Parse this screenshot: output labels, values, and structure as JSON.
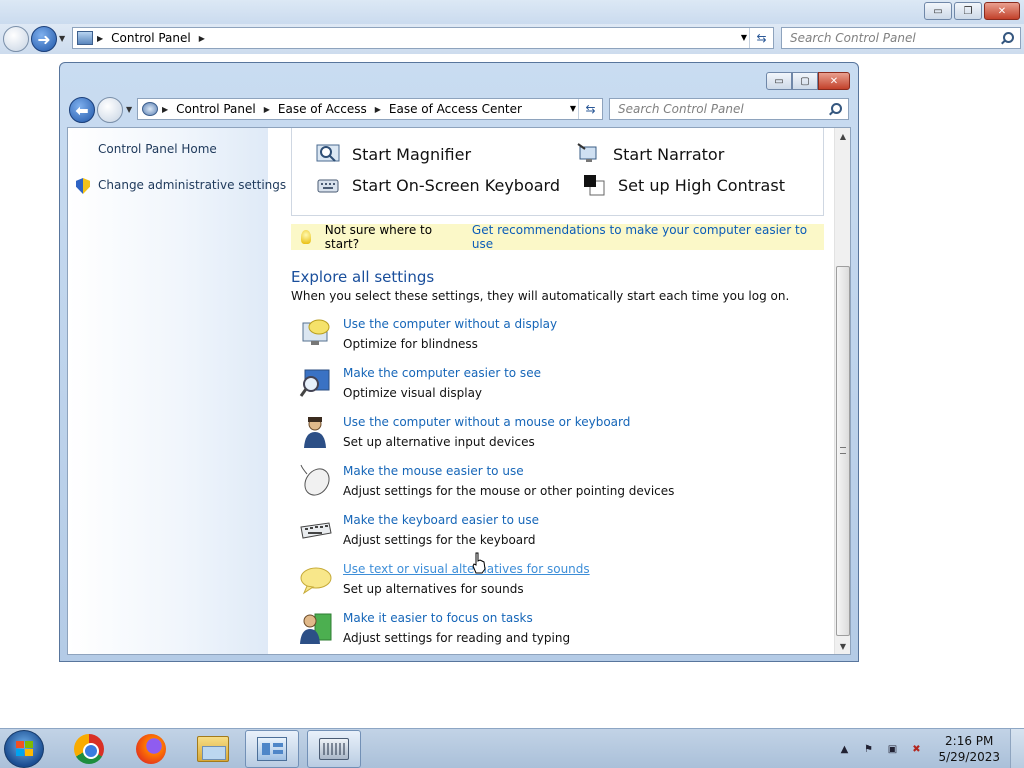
{
  "background_window": {
    "address_root": "Control Panel",
    "search_placeholder": "Search Control Panel",
    "buttons": {
      "minimize": "▭",
      "maximize": "❐",
      "close": "✕"
    }
  },
  "window": {
    "breadcrumb": [
      "Control Panel",
      "Ease of Access",
      "Ease of Access Center"
    ],
    "search_placeholder": "Search Control Panel",
    "buttons": {
      "minimize": "▭",
      "maximize": "▢",
      "close": "✕"
    }
  },
  "sidebar": {
    "home": "Control Panel Home",
    "admin": "Change administrative settings"
  },
  "quick_access": {
    "magnifier": "Start Magnifier",
    "narrator": "Start Narrator",
    "osk": "Start On-Screen Keyboard",
    "contrast": "Set up High Contrast"
  },
  "tip": {
    "text": "Not sure where to start?",
    "link": "Get recommendations to make your computer easier to use"
  },
  "explore": {
    "title": "Explore all settings",
    "description": "When you select these settings, they will automatically start each time you log on.",
    "settings": [
      {
        "link": "Use the computer without a display",
        "desc": "Optimize for blindness",
        "icon": "display-speech-icon"
      },
      {
        "link": "Make the computer easier to see",
        "desc": "Optimize visual display",
        "icon": "magnify-monitor-icon"
      },
      {
        "link": "Use the computer without a mouse or keyboard",
        "desc": "Set up alternative input devices",
        "icon": "person-icon"
      },
      {
        "link": "Make the mouse easier to use",
        "desc": "Adjust settings for the mouse or other pointing devices",
        "icon": "mouse-icon"
      },
      {
        "link": "Make the keyboard easier to use",
        "desc": "Adjust settings for the keyboard",
        "icon": "keyboard-icon"
      },
      {
        "link": "Use text or visual alternatives for sounds",
        "desc": "Set up alternatives for sounds",
        "icon": "speech-bubble-icon"
      },
      {
        "link": "Make it easier to focus on tasks",
        "desc": "Adjust settings for reading and typing",
        "icon": "focus-person-icon"
      }
    ]
  },
  "taskbar": {
    "apps": [
      "chrome",
      "firefox",
      "windows-explorer",
      "control-panel",
      "on-screen-keyboard"
    ],
    "time": "2:16 PM",
    "date": "5/29/2023"
  },
  "colors": {
    "link": "#1666b8",
    "heading": "#1a4f9c",
    "tip_bg": "#fbf8c8"
  }
}
